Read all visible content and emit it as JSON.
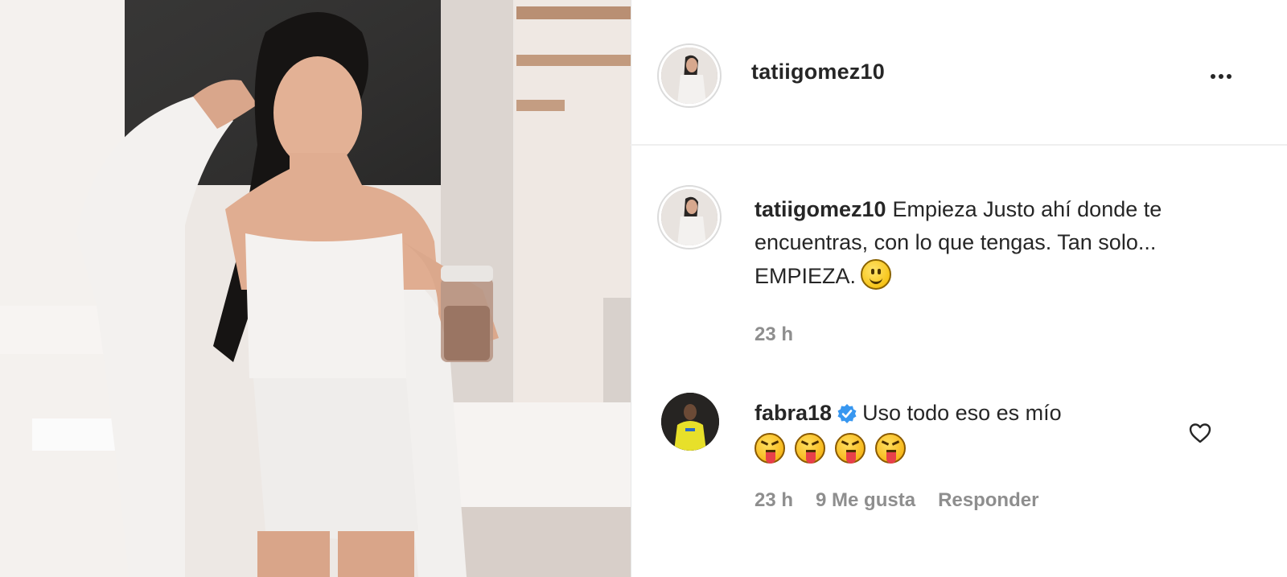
{
  "post": {
    "author": "tatiigomez10"
  },
  "header": {
    "username": "tatiigomez10",
    "more_icon": "more-horizontal-icon"
  },
  "caption": {
    "username": "tatiigomez10",
    "text": "Empieza Justo ahí donde te encuentras, con lo que tengas. Tan solo... EMPIEZA.",
    "emoji": "slightly-smiling-face",
    "time": "23 h"
  },
  "comment": {
    "username": "fabra18",
    "verified_icon": "verified-badge-icon",
    "text": "Uso todo eso es mío",
    "emojis": [
      "squinting-face-with-tongue",
      "squinting-face-with-tongue",
      "squinting-face-with-tongue",
      "squinting-face-with-tongue"
    ],
    "time": "23 h",
    "likes": "9 Me gusta",
    "reply_label": "Responder",
    "like_icon": "heart-outline-icon"
  },
  "colors": {
    "text": "#262626",
    "secondary": "#8e8e8e",
    "verified": "#3897f0",
    "divider": "#efefef"
  }
}
